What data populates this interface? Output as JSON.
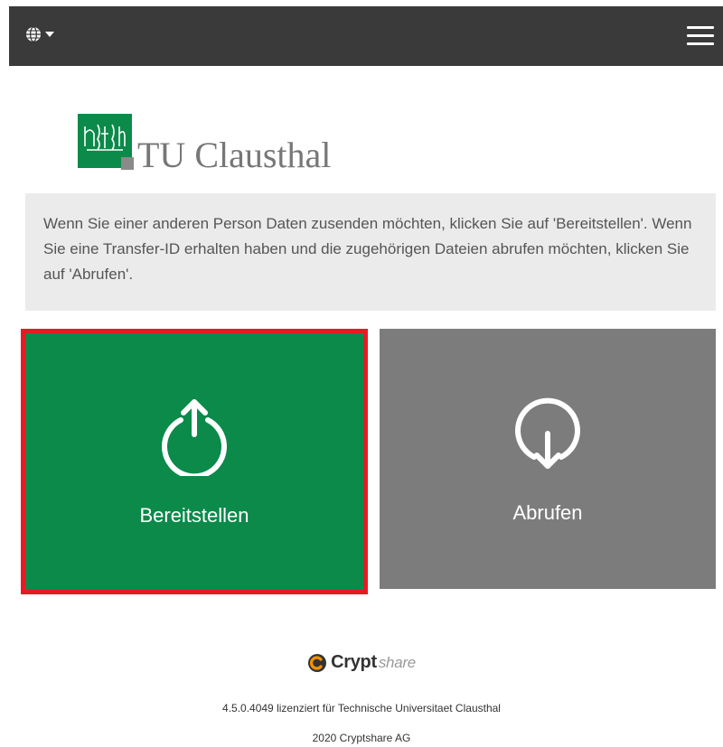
{
  "header": {
    "language_icon": "globe-icon",
    "menu_icon": "hamburger-menu-icon"
  },
  "logo": {
    "text": "TU Clausthal",
    "mark_color": "#0b8a4a"
  },
  "info": {
    "text": "Wenn Sie einer anderen Person Daten zusenden möchten, klicken Sie auf 'Bereitstellen'. Wenn Sie eine Transfer-ID erhalten haben und die zugehörigen Dateien abrufen möchten, klicken Sie auf 'Abrufen'."
  },
  "actions": {
    "upload": {
      "label": "Bereitstellen",
      "icon": "upload-circle-arrow-icon",
      "color": "#0b8a4a",
      "highlight": "#e51b24"
    },
    "download": {
      "label": "Abrufen",
      "icon": "download-circle-arrow-icon",
      "color": "#7c7c7c"
    }
  },
  "footer": {
    "brand_bold": "Crypt",
    "brand_rest": "share",
    "brand_tail": "",
    "license": "4.5.0.4049 lizenziert für Technische Universitaet Clausthal",
    "copyright": "2020 Cryptshare AG"
  }
}
